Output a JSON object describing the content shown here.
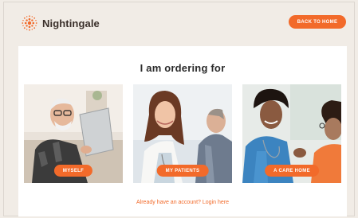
{
  "header": {
    "brand": "Nightingale",
    "back_label": "BACK TO HOME",
    "accent": "#f26a2a"
  },
  "main": {
    "title": "I am ordering for",
    "options": [
      {
        "label": "MYSELF"
      },
      {
        "label": "MY PATIENTS"
      },
      {
        "label": "A CARE HOME"
      }
    ],
    "login_text": "Already have an account? Login here"
  }
}
